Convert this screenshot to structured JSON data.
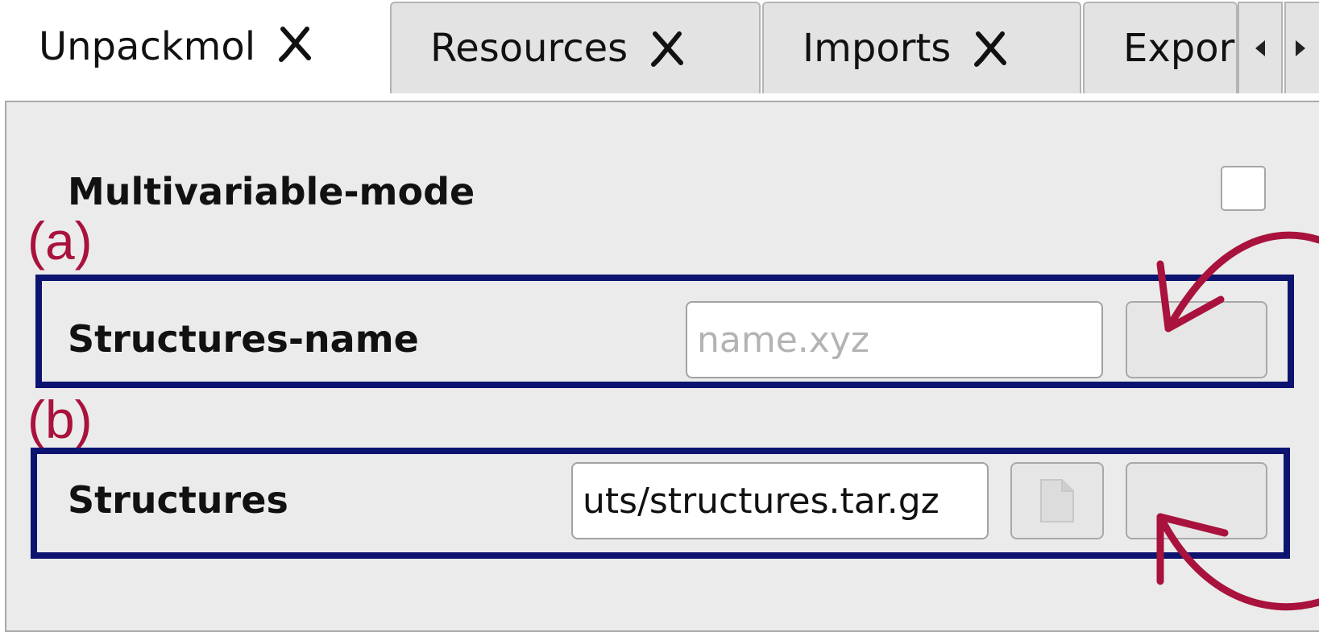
{
  "tabs": [
    {
      "label": "Unpackmol",
      "active": true,
      "closable": true
    },
    {
      "label": "Resources",
      "active": false,
      "closable": true
    },
    {
      "label": "Imports",
      "active": false,
      "closable": true
    },
    {
      "label": "Expor",
      "active": false,
      "closable": false
    }
  ],
  "tab_scroll": {
    "left_icon": "triangle-left-icon",
    "right_icon": "triangle-right-icon"
  },
  "panel": {
    "multivariable_mode": {
      "label": "Multivariable-mode",
      "checked": false
    },
    "structures_name": {
      "label": "Structures-name",
      "value": "",
      "placeholder": "name.xyz"
    },
    "structures": {
      "label": "Structures",
      "value": "uts/structures.tar.gz",
      "file_icon": "document-icon"
    }
  },
  "annotations": {
    "a": {
      "label": "(a)"
    },
    "b": {
      "label": "(b)"
    }
  },
  "colors": {
    "annotation_box": "#0d1470",
    "annotation_arrow": "#a8123c",
    "panel_background": "#ebebeb"
  }
}
